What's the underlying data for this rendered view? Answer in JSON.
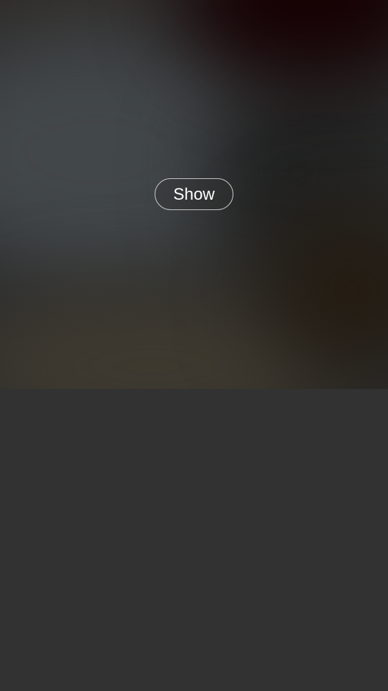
{
  "media": {
    "show_label": "Show"
  },
  "colors": {
    "background": "#323232",
    "button_border": "#c9c9c9",
    "button_text": "#ffffff"
  }
}
